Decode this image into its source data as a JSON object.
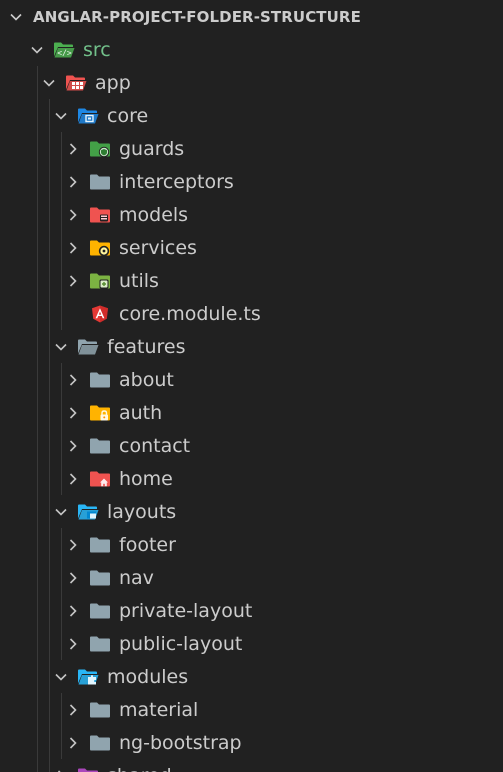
{
  "explorer": {
    "title": "ANGLAR-PROJECT-FOLDER-STRUCTURE"
  },
  "tree": [
    {
      "label": "src",
      "depth": 0,
      "twisty": "open",
      "icon": "folder-src-open-icon",
      "color": "#4caf50"
    },
    {
      "label": "app",
      "depth": 1,
      "twisty": "open",
      "icon": "folder-app-open-icon",
      "color": "#ef5350"
    },
    {
      "label": "core",
      "depth": 2,
      "twisty": "open",
      "icon": "folder-core-open-icon",
      "color": "#1e88e5"
    },
    {
      "label": "guards",
      "depth": 3,
      "twisty": "closed",
      "icon": "folder-guard-icon",
      "color": "#43a047"
    },
    {
      "label": "interceptors",
      "depth": 3,
      "twisty": "closed",
      "icon": "folder-icon",
      "color": "#90a4ae"
    },
    {
      "label": "models",
      "depth": 3,
      "twisty": "closed",
      "icon": "folder-database-icon",
      "color": "#ef5350"
    },
    {
      "label": "services",
      "depth": 3,
      "twisty": "closed",
      "icon": "folder-services-icon",
      "color": "#ffb300"
    },
    {
      "label": "utils",
      "depth": 3,
      "twisty": "closed",
      "icon": "folder-utils-icon",
      "color": "#7cb342"
    },
    {
      "label": "core.module.ts",
      "depth": 3,
      "twisty": "none",
      "icon": "angular-file-icon",
      "color": "#e53935"
    },
    {
      "label": "features",
      "depth": 2,
      "twisty": "open",
      "icon": "folder-open-icon",
      "color": "#90a4ae"
    },
    {
      "label": "about",
      "depth": 3,
      "twisty": "closed",
      "icon": "folder-icon",
      "color": "#90a4ae"
    },
    {
      "label": "auth",
      "depth": 3,
      "twisty": "closed",
      "icon": "folder-lock-icon",
      "color": "#ffb300"
    },
    {
      "label": "contact",
      "depth": 3,
      "twisty": "closed",
      "icon": "folder-icon",
      "color": "#90a4ae"
    },
    {
      "label": "home",
      "depth": 3,
      "twisty": "closed",
      "icon": "folder-home-icon",
      "color": "#ef5350"
    },
    {
      "label": "layouts",
      "depth": 2,
      "twisty": "open",
      "icon": "folder-layout-open-icon",
      "color": "#29b6f6"
    },
    {
      "label": "footer",
      "depth": 3,
      "twisty": "closed",
      "icon": "folder-icon",
      "color": "#90a4ae"
    },
    {
      "label": "nav",
      "depth": 3,
      "twisty": "closed",
      "icon": "folder-icon",
      "color": "#90a4ae"
    },
    {
      "label": "private-layout",
      "depth": 3,
      "twisty": "closed",
      "icon": "folder-icon",
      "color": "#90a4ae"
    },
    {
      "label": "public-layout",
      "depth": 3,
      "twisty": "closed",
      "icon": "folder-icon",
      "color": "#90a4ae"
    },
    {
      "label": "modules",
      "depth": 2,
      "twisty": "open",
      "icon": "folder-modules-open-icon",
      "color": "#29b6f6"
    },
    {
      "label": "material",
      "depth": 3,
      "twisty": "closed",
      "icon": "folder-icon",
      "color": "#90a4ae"
    },
    {
      "label": "ng-bootstrap",
      "depth": 3,
      "twisty": "closed",
      "icon": "folder-icon",
      "color": "#90a4ae"
    },
    {
      "label": "shared",
      "depth": 2,
      "twisty": "closed",
      "icon": "folder-shared-icon",
      "color": "#ab47bc"
    }
  ]
}
